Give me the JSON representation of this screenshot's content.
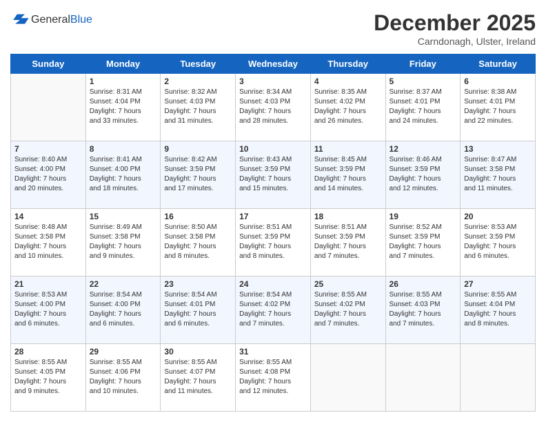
{
  "header": {
    "logo_general": "General",
    "logo_blue": "Blue",
    "month_title": "December 2025",
    "subtitle": "Carndonagh, Ulster, Ireland"
  },
  "days_of_week": [
    "Sunday",
    "Monday",
    "Tuesday",
    "Wednesday",
    "Thursday",
    "Friday",
    "Saturday"
  ],
  "weeks": [
    [
      {
        "day": "",
        "info": ""
      },
      {
        "day": "1",
        "info": "Sunrise: 8:31 AM\nSunset: 4:04 PM\nDaylight: 7 hours\nand 33 minutes."
      },
      {
        "day": "2",
        "info": "Sunrise: 8:32 AM\nSunset: 4:03 PM\nDaylight: 7 hours\nand 31 minutes."
      },
      {
        "day": "3",
        "info": "Sunrise: 8:34 AM\nSunset: 4:03 PM\nDaylight: 7 hours\nand 28 minutes."
      },
      {
        "day": "4",
        "info": "Sunrise: 8:35 AM\nSunset: 4:02 PM\nDaylight: 7 hours\nand 26 minutes."
      },
      {
        "day": "5",
        "info": "Sunrise: 8:37 AM\nSunset: 4:01 PM\nDaylight: 7 hours\nand 24 minutes."
      },
      {
        "day": "6",
        "info": "Sunrise: 8:38 AM\nSunset: 4:01 PM\nDaylight: 7 hours\nand 22 minutes."
      }
    ],
    [
      {
        "day": "7",
        "info": "Sunrise: 8:40 AM\nSunset: 4:00 PM\nDaylight: 7 hours\nand 20 minutes."
      },
      {
        "day": "8",
        "info": "Sunrise: 8:41 AM\nSunset: 4:00 PM\nDaylight: 7 hours\nand 18 minutes."
      },
      {
        "day": "9",
        "info": "Sunrise: 8:42 AM\nSunset: 3:59 PM\nDaylight: 7 hours\nand 17 minutes."
      },
      {
        "day": "10",
        "info": "Sunrise: 8:43 AM\nSunset: 3:59 PM\nDaylight: 7 hours\nand 15 minutes."
      },
      {
        "day": "11",
        "info": "Sunrise: 8:45 AM\nSunset: 3:59 PM\nDaylight: 7 hours\nand 14 minutes."
      },
      {
        "day": "12",
        "info": "Sunrise: 8:46 AM\nSunset: 3:59 PM\nDaylight: 7 hours\nand 12 minutes."
      },
      {
        "day": "13",
        "info": "Sunrise: 8:47 AM\nSunset: 3:58 PM\nDaylight: 7 hours\nand 11 minutes."
      }
    ],
    [
      {
        "day": "14",
        "info": "Sunrise: 8:48 AM\nSunset: 3:58 PM\nDaylight: 7 hours\nand 10 minutes."
      },
      {
        "day": "15",
        "info": "Sunrise: 8:49 AM\nSunset: 3:58 PM\nDaylight: 7 hours\nand 9 minutes."
      },
      {
        "day": "16",
        "info": "Sunrise: 8:50 AM\nSunset: 3:58 PM\nDaylight: 7 hours\nand 8 minutes."
      },
      {
        "day": "17",
        "info": "Sunrise: 8:51 AM\nSunset: 3:59 PM\nDaylight: 7 hours\nand 8 minutes."
      },
      {
        "day": "18",
        "info": "Sunrise: 8:51 AM\nSunset: 3:59 PM\nDaylight: 7 hours\nand 7 minutes."
      },
      {
        "day": "19",
        "info": "Sunrise: 8:52 AM\nSunset: 3:59 PM\nDaylight: 7 hours\nand 7 minutes."
      },
      {
        "day": "20",
        "info": "Sunrise: 8:53 AM\nSunset: 3:59 PM\nDaylight: 7 hours\nand 6 minutes."
      }
    ],
    [
      {
        "day": "21",
        "info": "Sunrise: 8:53 AM\nSunset: 4:00 PM\nDaylight: 7 hours\nand 6 minutes."
      },
      {
        "day": "22",
        "info": "Sunrise: 8:54 AM\nSunset: 4:00 PM\nDaylight: 7 hours\nand 6 minutes."
      },
      {
        "day": "23",
        "info": "Sunrise: 8:54 AM\nSunset: 4:01 PM\nDaylight: 7 hours\nand 6 minutes."
      },
      {
        "day": "24",
        "info": "Sunrise: 8:54 AM\nSunset: 4:02 PM\nDaylight: 7 hours\nand 7 minutes."
      },
      {
        "day": "25",
        "info": "Sunrise: 8:55 AM\nSunset: 4:02 PM\nDaylight: 7 hours\nand 7 minutes."
      },
      {
        "day": "26",
        "info": "Sunrise: 8:55 AM\nSunset: 4:03 PM\nDaylight: 7 hours\nand 7 minutes."
      },
      {
        "day": "27",
        "info": "Sunrise: 8:55 AM\nSunset: 4:04 PM\nDaylight: 7 hours\nand 8 minutes."
      }
    ],
    [
      {
        "day": "28",
        "info": "Sunrise: 8:55 AM\nSunset: 4:05 PM\nDaylight: 7 hours\nand 9 minutes."
      },
      {
        "day": "29",
        "info": "Sunrise: 8:55 AM\nSunset: 4:06 PM\nDaylight: 7 hours\nand 10 minutes."
      },
      {
        "day": "30",
        "info": "Sunrise: 8:55 AM\nSunset: 4:07 PM\nDaylight: 7 hours\nand 11 minutes."
      },
      {
        "day": "31",
        "info": "Sunrise: 8:55 AM\nSunset: 4:08 PM\nDaylight: 7 hours\nand 12 minutes."
      },
      {
        "day": "",
        "info": ""
      },
      {
        "day": "",
        "info": ""
      },
      {
        "day": "",
        "info": ""
      }
    ]
  ]
}
